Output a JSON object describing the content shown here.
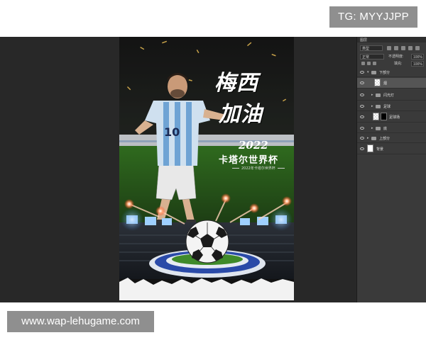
{
  "watermarks": {
    "top": "TG: MYYJJPP",
    "bottom": "www.wap-lehugame.com"
  },
  "poster": {
    "title_line1": "梅西",
    "title_line2": "加油",
    "year": "2022",
    "event": "卡塔尔世界杯",
    "subtitle": "2022年卡塔尔世界杯"
  },
  "panel": {
    "tab_label": "图层",
    "filter_type": "类型",
    "blend_mode": "正常",
    "opacity_label": "不透明度:",
    "opacity_value": "100%",
    "fill_label": "填充:",
    "fill_value": "100%",
    "layers": [
      {
        "name": "下部分",
        "kind": "group"
      },
      {
        "name": "烟",
        "kind": "pixel"
      },
      {
        "name": "闪光灯",
        "kind": "group"
      },
      {
        "name": "足球",
        "kind": "group"
      },
      {
        "name": "足球场",
        "kind": "masked"
      },
      {
        "name": "底",
        "kind": "group"
      },
      {
        "name": "上部分",
        "kind": "group"
      },
      {
        "name": "背景",
        "kind": "background"
      }
    ]
  },
  "colors": {
    "workspace": "#282828",
    "panel": "#3a3a3a",
    "watermark_bg": "#8f8f8f",
    "pitch_blue": "#2a4aa8",
    "flare": "#ff6a3a"
  }
}
